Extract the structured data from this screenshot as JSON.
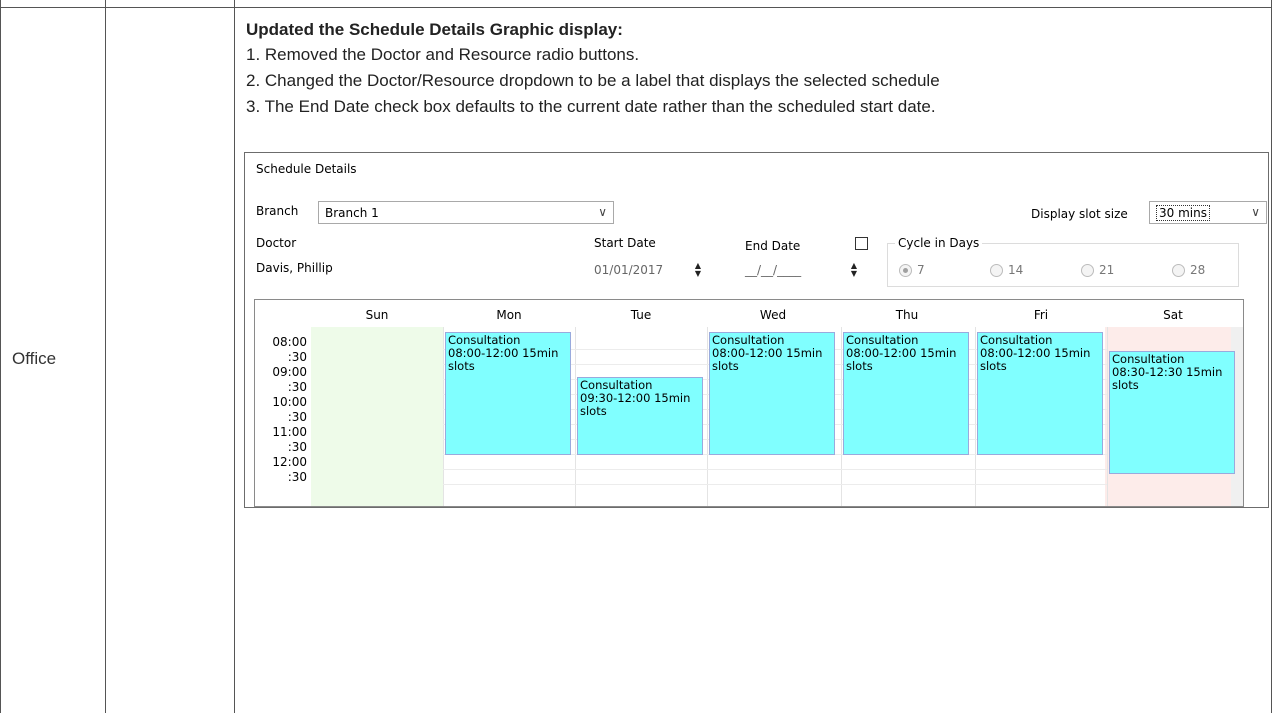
{
  "row_label": "Office",
  "notes": {
    "heading": "Updated the Schedule Details Graphic display:",
    "items": [
      "1. Removed the Doctor and Resource radio buttons.",
      "2. Changed the Doctor/Resource dropdown to be a label that displays the selected schedule",
      "3. The End Date check box defaults to the current date rather than the scheduled start date."
    ]
  },
  "dialog": {
    "title": "Schedule Details",
    "branch_label": "Branch",
    "branch_value": "Branch 1",
    "slot_size_label": "Display slot size",
    "slot_size_value": "30 mins",
    "doctor_label": "Doctor",
    "doctor_value": "Davis, Phillip",
    "start_date_label": "Start Date",
    "start_date_value": "01/01/2017",
    "end_date_label": "End Date",
    "end_date_value": "__/__/____",
    "end_date_checked": false,
    "cycle_label": "Cycle in Days",
    "cycle_options": [
      "7",
      "14",
      "21",
      "28"
    ],
    "cycle_selected": "7"
  },
  "calendar": {
    "days": [
      "Sun",
      "Mon",
      "Tue",
      "Wed",
      "Thu",
      "Fri",
      "Sat"
    ],
    "times": [
      "08:00",
      ":30",
      "09:00",
      ":30",
      "10:00",
      ":30",
      "11:00",
      ":30",
      "12:00",
      ":30"
    ],
    "appointments": [
      {
        "day": "Mon",
        "title": "Consultation",
        "detail": "08:00-12:00 15min",
        "extra": "slots",
        "start": "08:00",
        "end": "12:00"
      },
      {
        "day": "Tue",
        "title": "Consultation",
        "detail": "09:30-12:00 15min",
        "extra": "slots",
        "start": "09:30",
        "end": "12:00"
      },
      {
        "day": "Wed",
        "title": "Consultation",
        "detail": "08:00-12:00 15min",
        "extra": "slots",
        "start": "08:00",
        "end": "12:00"
      },
      {
        "day": "Thu",
        "title": "Consultation",
        "detail": "08:00-12:00 15min",
        "extra": "slots",
        "start": "08:00",
        "end": "12:00"
      },
      {
        "day": "Fri",
        "title": "Consultation",
        "detail": "08:00-12:00 15min",
        "extra": "slots",
        "start": "08:00",
        "end": "12:00"
      },
      {
        "day": "Sat",
        "title": "Consultation",
        "detail": "08:30-12:30 15min",
        "extra": "slots",
        "start": "08:30",
        "end": "12:30"
      }
    ],
    "colors": {
      "appointment": "#80ffff",
      "sunday_bg": "#eefbe9",
      "saturday_bg": "#fdecea"
    }
  }
}
